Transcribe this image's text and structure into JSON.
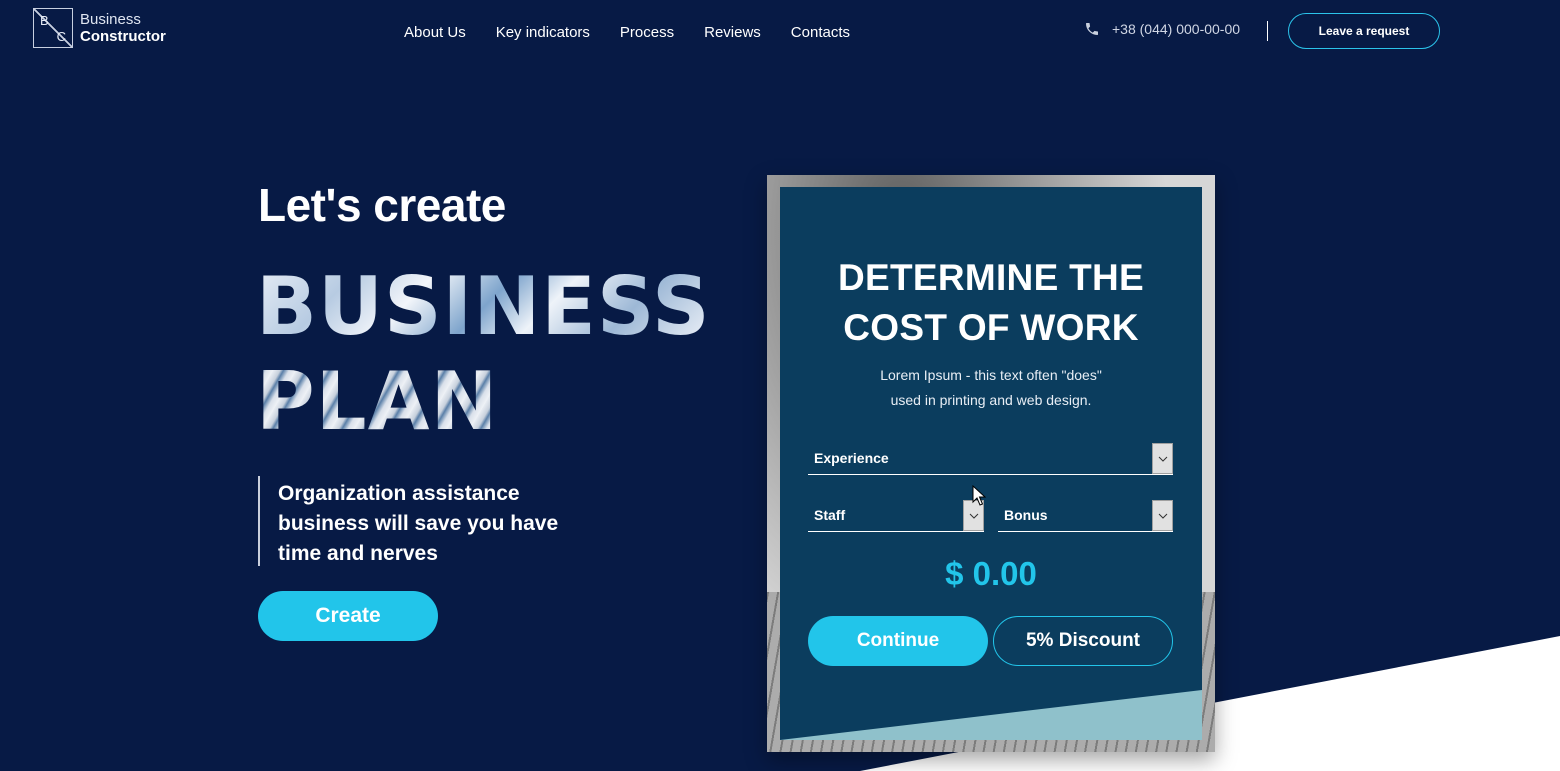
{
  "brand": {
    "logo_letter_1": "B",
    "logo_letter_2": "C",
    "line1": "Business",
    "line2": "Constructor"
  },
  "nav": [
    "About Us",
    "Key indicators",
    "Process",
    "Reviews",
    "Contacts"
  ],
  "header": {
    "phone": "+38 (044) 000-00-00",
    "request_button": "Leave a request",
    "phone_icon": "phone-icon"
  },
  "hero": {
    "title": "Let's create",
    "big_line1": "BUSINESS",
    "big_line2": "PLAN",
    "quote": "Organization assistance business will save you have time and nerves",
    "create_button": "Create"
  },
  "calculator": {
    "title_line1": "DETERMINE THE",
    "title_line2": "COST OF WORK",
    "desc_line1": "Lorem Ipsum - this text often \"does\"",
    "desc_line2": "used in printing and web design.",
    "experience_select": "Experience",
    "staff_select": "Staff",
    "bonus_select": "Bonus",
    "price": "$ 0.00",
    "continue_button": "Continue",
    "discount_button": "5% Discount"
  },
  "colors": {
    "background": "#071a45",
    "accent": "#22c5ea",
    "card": "#0b3d5e"
  }
}
